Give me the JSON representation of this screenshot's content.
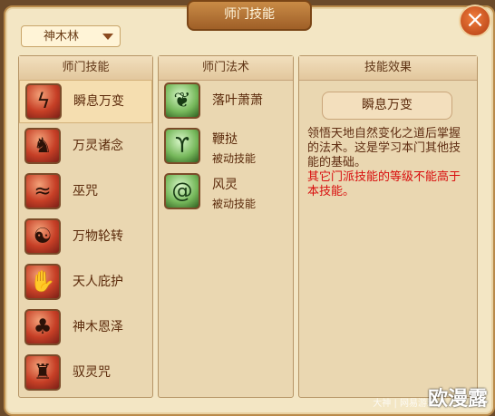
{
  "window": {
    "title": "师门技能"
  },
  "school_select": {
    "value": "神木林"
  },
  "columns": {
    "skills_header": "师门技能",
    "spells_header": "师门法术",
    "effect_header": "技能效果"
  },
  "skills": [
    {
      "name": "瞬息万变",
      "icon": "lightning-icon",
      "selected": true
    },
    {
      "name": "万灵诸念",
      "icon": "beast-icon"
    },
    {
      "name": "巫咒",
      "icon": "flame-icon"
    },
    {
      "name": "万物轮转",
      "icon": "yin-yang-icon"
    },
    {
      "name": "天人庇护",
      "icon": "hands-icon"
    },
    {
      "name": "神木恩泽",
      "icon": "tree-icon"
    },
    {
      "name": "驭灵咒",
      "icon": "spirit-icon"
    }
  ],
  "spells": [
    {
      "name": "落叶萧萧",
      "icon": "leaves-icon"
    },
    {
      "name": "鞭挞",
      "sub": "被动技能",
      "icon": "whip-icon"
    },
    {
      "name": "风灵",
      "sub": "被动技能",
      "icon": "wind-icon"
    }
  ],
  "effect": {
    "title": "瞬息万变",
    "desc": "领悟天地自然变化之道后掌握的法术。这是学习本门其他技能的基础。",
    "note": "其它门派技能的等级不能高于本技能。"
  },
  "watermark": {
    "site": "欧漫露",
    "small": "大神 | 网易游戏"
  }
}
